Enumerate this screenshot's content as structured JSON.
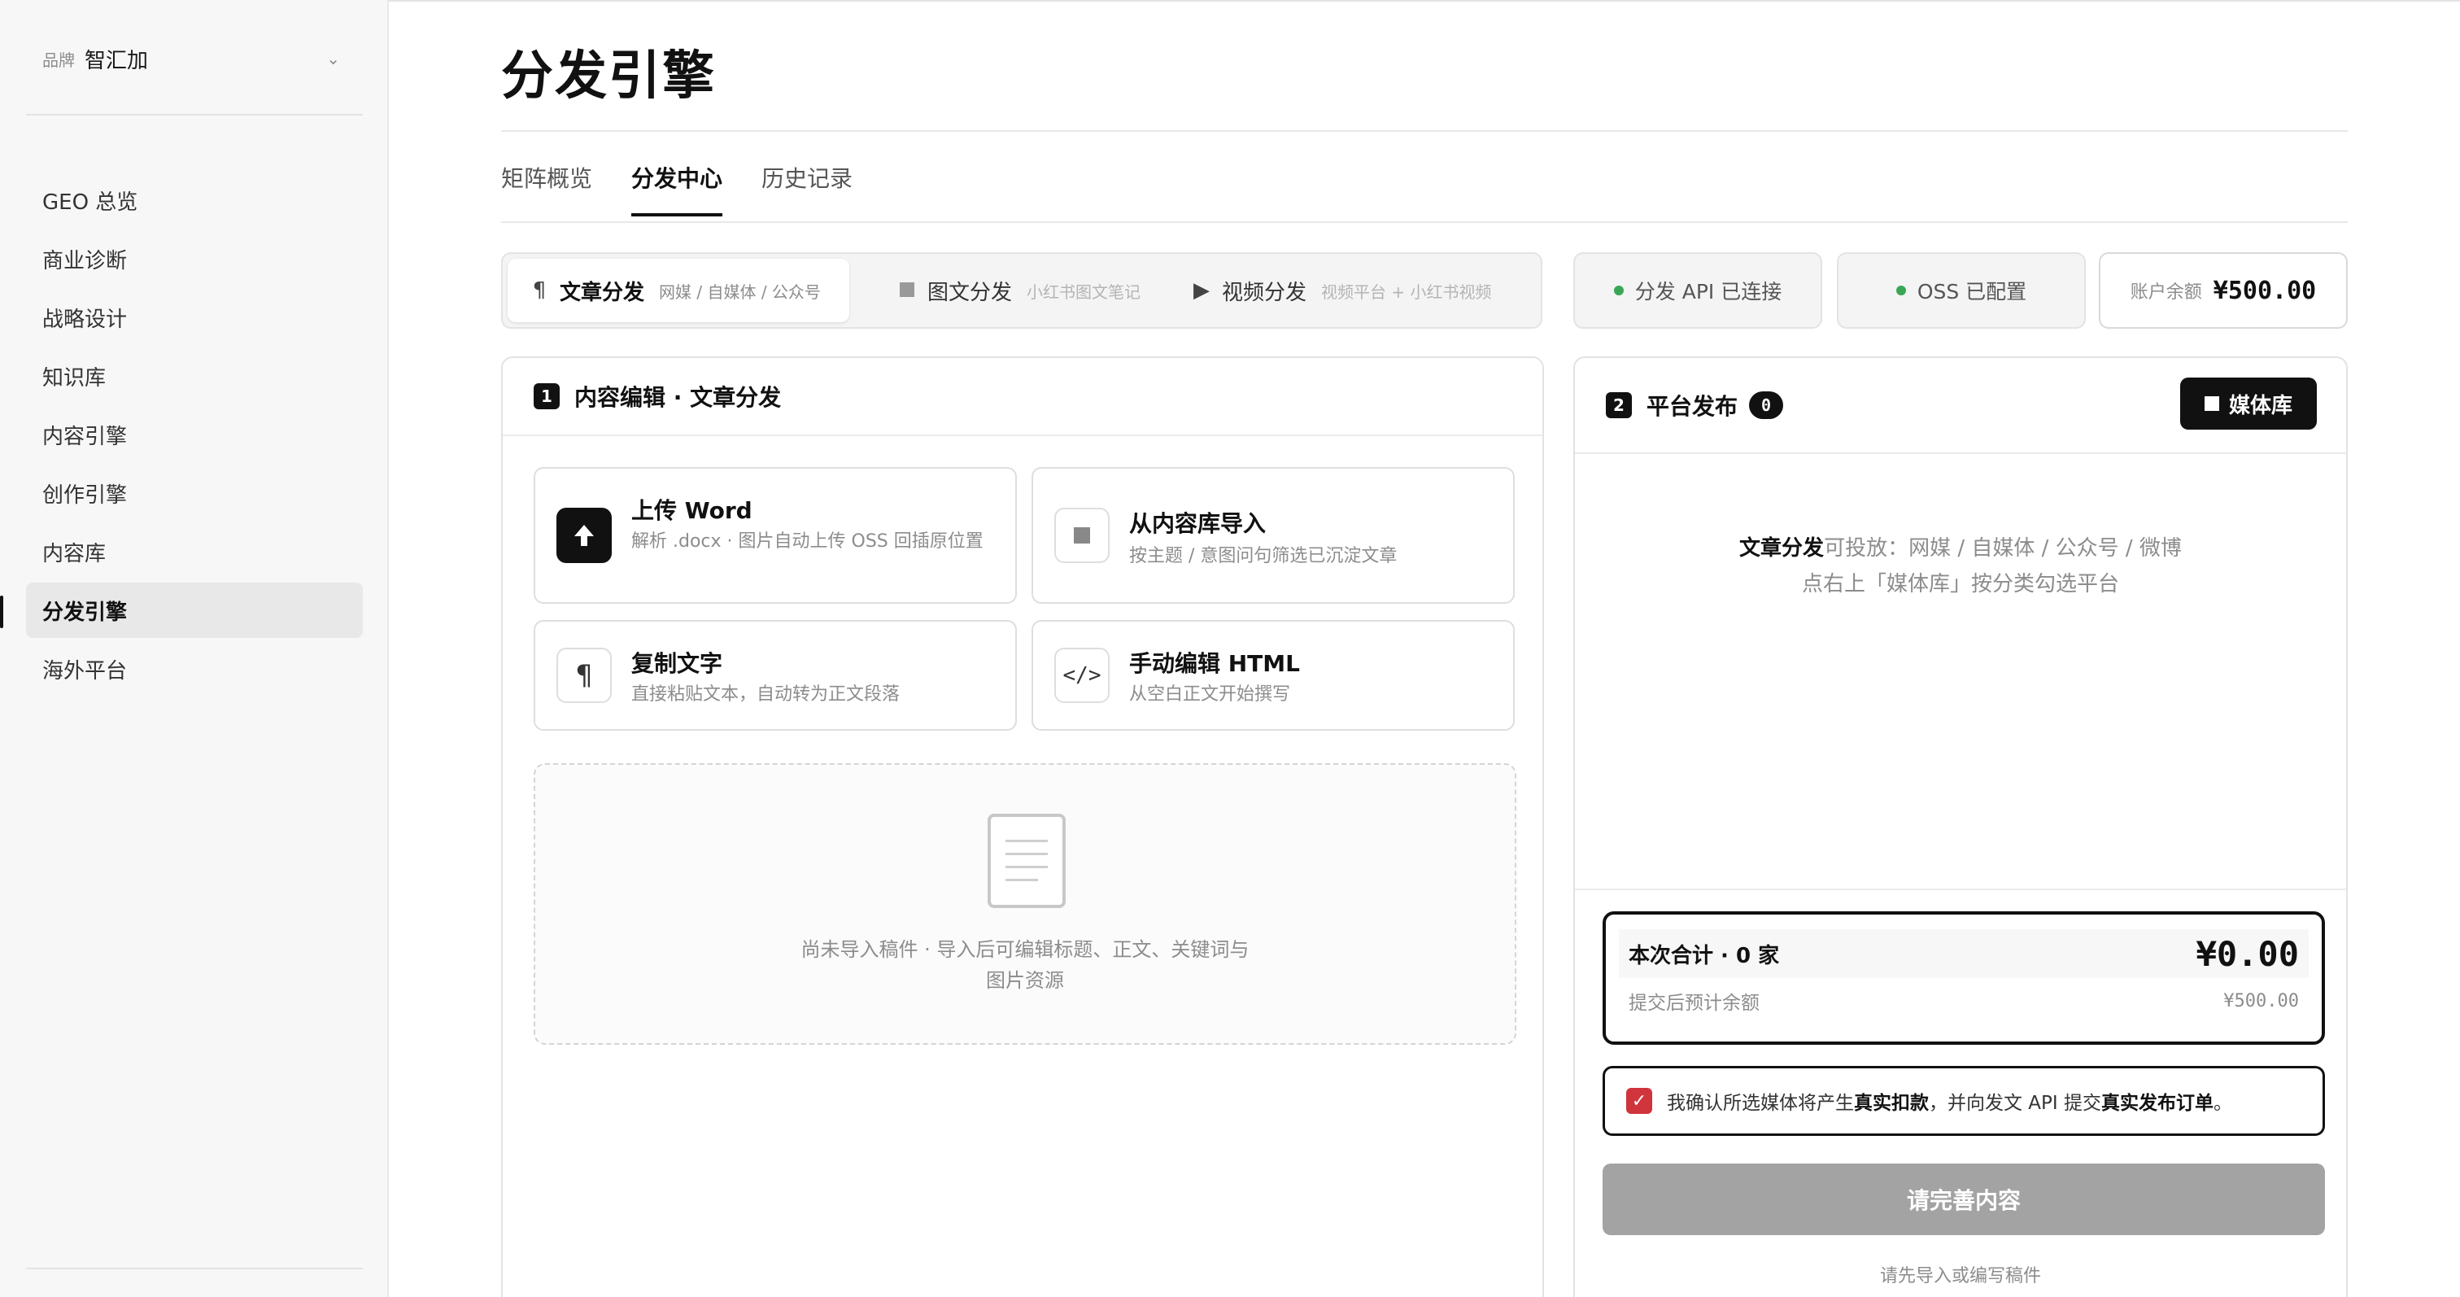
{
  "sidebar": {
    "brand_label": "品牌",
    "brand_name": "智汇加",
    "items": [
      {
        "label": "GEO 总览"
      },
      {
        "label": "商业诊断"
      },
      {
        "label": "战略设计"
      },
      {
        "label": "知识库"
      },
      {
        "label": "内容引擎"
      },
      {
        "label": "创作引擎"
      },
      {
        "label": "内容库"
      },
      {
        "label": "分发引擎",
        "active": true
      },
      {
        "label": "海外平台"
      }
    ]
  },
  "page": {
    "title": "分发引擎",
    "tabs": [
      {
        "label": "矩阵概览"
      },
      {
        "label": "分发中心",
        "active": true
      },
      {
        "label": "历史记录"
      }
    ]
  },
  "modes": [
    {
      "icon": "pilcrow-icon",
      "label": "文章分发",
      "sub": "网媒 / 自媒体 / 公众号",
      "active": true
    },
    {
      "icon": "image-icon",
      "label": "图文分发",
      "sub": "小红书图文笔记"
    },
    {
      "icon": "play-icon",
      "label": "视频分发",
      "sub": "视频平台 + 小红书视频"
    }
  ],
  "status": {
    "api": "分发 API 已连接",
    "oss": "OSS 已配置",
    "balance_label": "账户余额",
    "balance_value": "¥500.00",
    "ok_color": "#3aa655"
  },
  "editor": {
    "step": "1",
    "title": "内容编辑 · 文章分发",
    "options": [
      {
        "icon": "upload-icon",
        "title": "上传 Word",
        "desc": "解析 .docx · 图片自动上传 OSS 回插原位置"
      },
      {
        "icon": "library-icon",
        "title": "从内容库导入",
        "desc": "按主题 / 意图问句筛选已沉淀文章"
      },
      {
        "icon": "pilcrow-icon",
        "title": "复制文字",
        "desc": "直接粘贴文本，自动转为正文段落"
      },
      {
        "icon": "code-icon",
        "title": "手动编辑 HTML",
        "desc": "从空白正文开始撰写"
      }
    ],
    "empty_line1": "尚未导入稿件 · 导入后可编辑标题、正文、关键词与",
    "empty_line2": "图片资源"
  },
  "publish": {
    "step": "2",
    "title": "平台发布",
    "count": "0",
    "media_button": "媒体库",
    "hint_bold": "文章分发",
    "hint_rest": "可投放：网媒 / 自媒体 / 公众号 / 微博",
    "hint_line2": "点右上「媒体库」按分类勾选平台",
    "total_label": "本次合计 · 0 家",
    "total_value": "¥0.00",
    "est_label": "提交后预计余额",
    "est_value": "¥500.00",
    "confirm_pre": "我确认所选媒体将产生",
    "confirm_b1": "真实扣款",
    "confirm_mid": "，并向发文 API 提交",
    "confirm_b2": "真实发布订单",
    "confirm_post": "。",
    "confirm_checked": true,
    "checkbox_color": "#d0343c",
    "submit_label": "请完善内容",
    "submit_hint": "请先导入或编写稿件"
  }
}
